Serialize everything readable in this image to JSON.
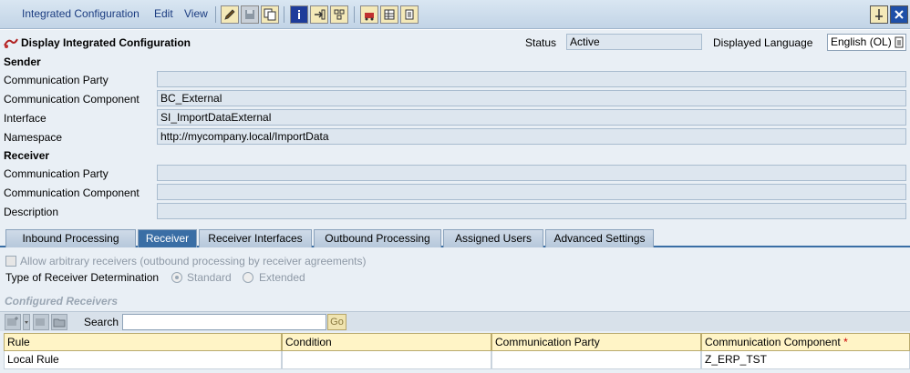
{
  "menu": {
    "items": [
      "Integrated Configuration",
      "Edit",
      "View"
    ],
    "underlined_first_letter": [
      "I",
      "E",
      "V"
    ]
  },
  "toolbar": {
    "buttons": [
      "edit-icon",
      "save-icon",
      "copy-icon",
      "info-icon",
      "navigate-icon",
      "where-used-icon",
      "transport-icon",
      "grid-icon",
      "history-icon"
    ],
    "window_buttons": [
      "pin-icon",
      "close-icon"
    ]
  },
  "header": {
    "title": "Display Integrated Configuration",
    "status_label": "Status",
    "status_value": "Active",
    "language_label": "Displayed Language",
    "language_value": "English (OL)"
  },
  "sender": {
    "heading": "Sender",
    "party_label": "Communication Party",
    "party_value": "",
    "component_label": "Communication Component",
    "component_value": "BC_External",
    "interface_label": "Interface",
    "interface_value": "SI_ImportDataExternal",
    "namespace_label": "Namespace",
    "namespace_value": "http://mycompany.local/ImportData"
  },
  "receiver": {
    "heading": "Receiver",
    "party_label": "Communication Party",
    "party_value": "",
    "component_label": "Communication Component",
    "component_value": "",
    "description_label": "Description",
    "description_value": ""
  },
  "tabs": [
    {
      "label": "Inbound Processing",
      "active": false
    },
    {
      "label": "Receiver",
      "active": true
    },
    {
      "label": "Receiver Interfaces",
      "active": false
    },
    {
      "label": "Outbound Processing",
      "active": false
    },
    {
      "label": "Assigned Users",
      "active": false
    },
    {
      "label": "Advanced Settings",
      "active": false
    }
  ],
  "receiver_tab": {
    "allow_arbitrary_label": "Allow arbitrary receivers (outbound processing by receiver agreements)",
    "allow_arbitrary_checked": false,
    "determination_label": "Type of Receiver Determination",
    "option_standard": "Standard",
    "option_extended": "Extended",
    "selected_option": "Standard",
    "configured_title": "Configured Receivers",
    "search_label": "Search",
    "search_value": "",
    "go_label": "Go"
  },
  "table": {
    "columns": [
      "Rule",
      "Condition",
      "Communication Party",
      "Communication Component"
    ],
    "required_marker": "*",
    "rows": [
      [
        "Local Rule",
        "",
        "",
        "Z_ERP_TST"
      ]
    ]
  },
  "colors": {
    "active_tab": "#3a6ea5",
    "field_bg": "#dde6ef",
    "header_row_bg": "#fff4c6"
  }
}
